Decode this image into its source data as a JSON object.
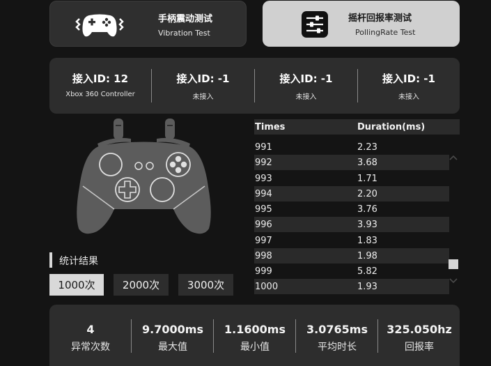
{
  "modes": {
    "vibration": {
      "title": "手柄震动测试",
      "subtitle": "Vibration Test"
    },
    "polling": {
      "title": "摇杆回报率测试",
      "subtitle": "PollingRate Test"
    }
  },
  "controllers": [
    {
      "id": "接入ID: 12",
      "status": "Xbox 360 Controller"
    },
    {
      "id": "接入ID: -1",
      "status": "未接入"
    },
    {
      "id": "接入ID: -1",
      "status": "未接入"
    },
    {
      "id": "接入ID: -1",
      "status": "未接入"
    }
  ],
  "stats": {
    "label": "统计结果",
    "counts": [
      "1000次",
      "2000次",
      "3000次"
    ],
    "selected": "1000次"
  },
  "table": {
    "headers": [
      "Times",
      "Duration(ms)"
    ],
    "rows": [
      [
        "991",
        "2.23"
      ],
      [
        "992",
        "3.68"
      ],
      [
        "993",
        "1.71"
      ],
      [
        "994",
        "2.20"
      ],
      [
        "995",
        "3.76"
      ],
      [
        "996",
        "3.93"
      ],
      [
        "997",
        "1.83"
      ],
      [
        "998",
        "1.98"
      ],
      [
        "999",
        "5.82"
      ],
      [
        "1000",
        "1.93"
      ]
    ]
  },
  "summary": [
    {
      "value": "4",
      "label": "异常次数"
    },
    {
      "value": "9.7000ms",
      "label": "最大值"
    },
    {
      "value": "1.1600ms",
      "label": "最小值"
    },
    {
      "value": "3.0765ms",
      "label": "平均时长"
    },
    {
      "value": "325.050hz",
      "label": "回报率"
    }
  ],
  "colors": {
    "background": "#141414",
    "panel": "#2d2d2d",
    "active": "#d9d9d9"
  },
  "icons": {
    "vibration": "gamepad-vibration-icon",
    "polling": "sliders-icon",
    "controller": "xbox-controller-icon"
  }
}
